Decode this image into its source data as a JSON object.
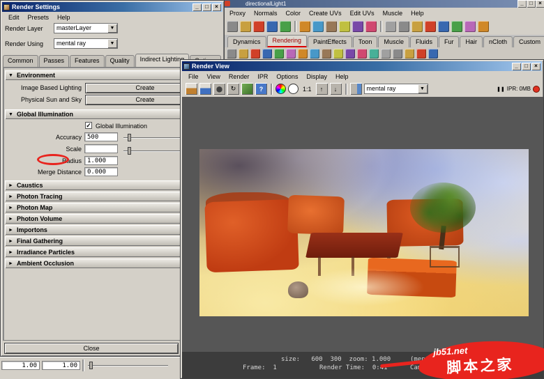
{
  "chrome": {
    "min": "_",
    "max": "□",
    "close": "×",
    "dd": "▼",
    "right": "►",
    "down": "▼",
    "check": "✓",
    "pause": "❚❚",
    "help": "?",
    "up": "↑",
    "dn": "↓",
    "redo": "↻"
  },
  "maya": {
    "window_title": "directionalLight1",
    "menus": [
      "Proxy",
      "Normals",
      "Color",
      "Create UVs",
      "Edit UVs",
      "Muscle",
      "Help"
    ],
    "shelf_tabs": [
      "Dynamics",
      "Rendering",
      "PaintEffects",
      "Toon",
      "Muscle",
      "Fluids",
      "Fur",
      "Hair",
      "nCloth",
      "Custom"
    ],
    "bottom_field_1": "1.00",
    "bottom_field_2": "1.00"
  },
  "render_settings": {
    "title": "Render Settings",
    "menus": [
      "Edit",
      "Presets",
      "Help"
    ],
    "render_layer_label": "Render Layer",
    "render_layer_value": "masterLayer",
    "render_using_label": "Render Using",
    "render_using_value": "mental ray",
    "tabs": [
      "Common",
      "Passes",
      "Features",
      "Quality",
      "Indirect Lighting",
      "Options"
    ],
    "environment_header": "Environment",
    "ibl_label": "Image Based Lighting",
    "ibl_button": "Create",
    "pss_label": "Physical Sun and Sky",
    "pss_button": "Create",
    "gi_header": "Global Illumination",
    "gi_checkbox_label": "Global Illumination",
    "accuracy_label": "Accuracy",
    "accuracy_value": "500",
    "scale_label": "Scale",
    "scale_value": "",
    "radius_label": "Radius",
    "radius_value": "1.000",
    "merge_label": "Merge Distance",
    "merge_value": "0.000",
    "sections": [
      "Caustics",
      "Photon Tracing",
      "Photon Map",
      "Photon Volume",
      "Importons",
      "Final Gathering",
      "Irradiance Particles",
      "Ambient Occlusion"
    ],
    "close_button": "Close"
  },
  "render_view": {
    "title": "Render View",
    "menus": [
      "File",
      "View",
      "Render",
      "IPR",
      "Options",
      "Display",
      "Help"
    ],
    "toolbar": {
      "zoom_ratio": "1:1",
      "renderer": "mental ray",
      "ipr_memory": "IPR: 0MB"
    },
    "status": {
      "size_text": "size:   600  300  zoom: 1.000",
      "renderer_text": "(mental ray)",
      "frame_text": "Frame:  1",
      "time_text": "Render Time:  0:41",
      "camera_text": "Camera: camera"
    }
  },
  "watermark": {
    "site": "jb51.net",
    "name": "脚本之家"
  }
}
